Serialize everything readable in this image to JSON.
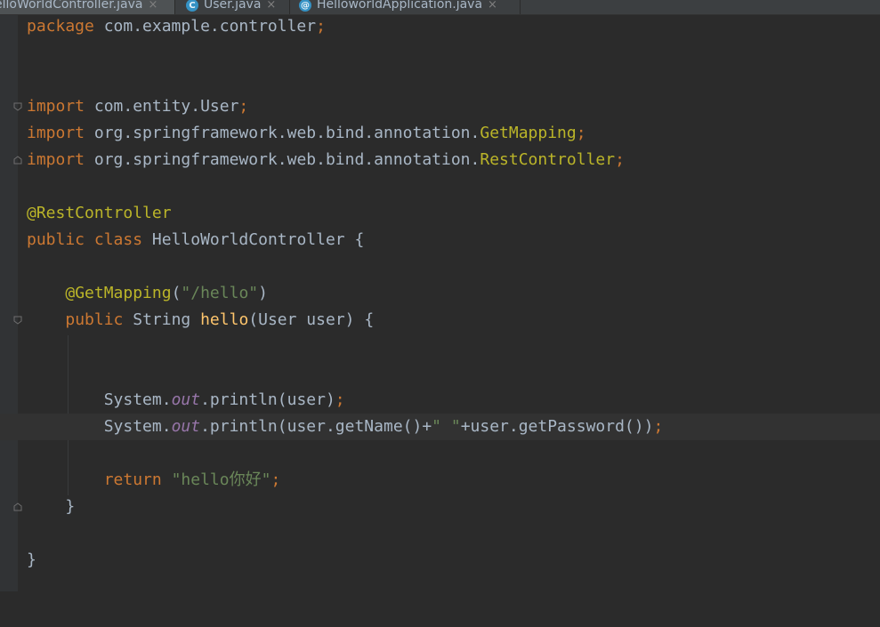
{
  "tabs": [
    {
      "label": "elloWorldController.java",
      "active": true,
      "icon": ""
    },
    {
      "label": "User.java",
      "active": false,
      "icon": "C"
    },
    {
      "label": "HelloworldApplication.java",
      "active": false,
      "icon": "@"
    }
  ],
  "tab_close_glyph": "×",
  "code": {
    "l1": {
      "kw": "package",
      "pkg": " com.example.controller",
      "semi": ";"
    },
    "l4": {
      "kw": "import",
      "pkg": " com.entity.User",
      "semi": ";"
    },
    "l5": {
      "kw": "import",
      "pkg": " org.springframework.web.bind.annotation.",
      "cls": "GetMapping",
      "semi": ";"
    },
    "l6": {
      "kw": "import",
      "pkg": " org.springframework.web.bind.annotation.",
      "cls": "RestController",
      "semi": ";"
    },
    "l8": {
      "ann": "@RestController"
    },
    "l9": {
      "kw1": "public",
      "kw2": " class",
      "name": " HelloWorldController {"
    },
    "l11": {
      "indent": "    ",
      "ann": "@GetMapping",
      "open": "(",
      "str": "\"/hello\"",
      "close": ")"
    },
    "l12": {
      "indent": "    ",
      "kw": "public",
      "type": " String ",
      "fn": "hello",
      "args": "(User user) {"
    },
    "l15": {
      "indent": "        ",
      "pre": "System.",
      "field": "out",
      "post": ".println(user)",
      "semi": ";"
    },
    "l16": {
      "indent": "        ",
      "pre": "System.",
      "field": "out",
      "mid": ".println(user.getName()+",
      "str": "\" \"",
      "post": "+user.getPassword())",
      "semi": ";"
    },
    "l18": {
      "indent": "        ",
      "kw": "return",
      "sp": " ",
      "str": "\"hello你好\"",
      "semi": ";"
    },
    "l19": {
      "text": "    }"
    },
    "l21": {
      "text": "}"
    }
  },
  "colors": {
    "background": "#2b2b2b",
    "keyword": "#cc7832",
    "annotation": "#bbb529",
    "string": "#6a8759",
    "static_field": "#9876aa",
    "method": "#ffc66d",
    "text": "#a9b7c6"
  }
}
